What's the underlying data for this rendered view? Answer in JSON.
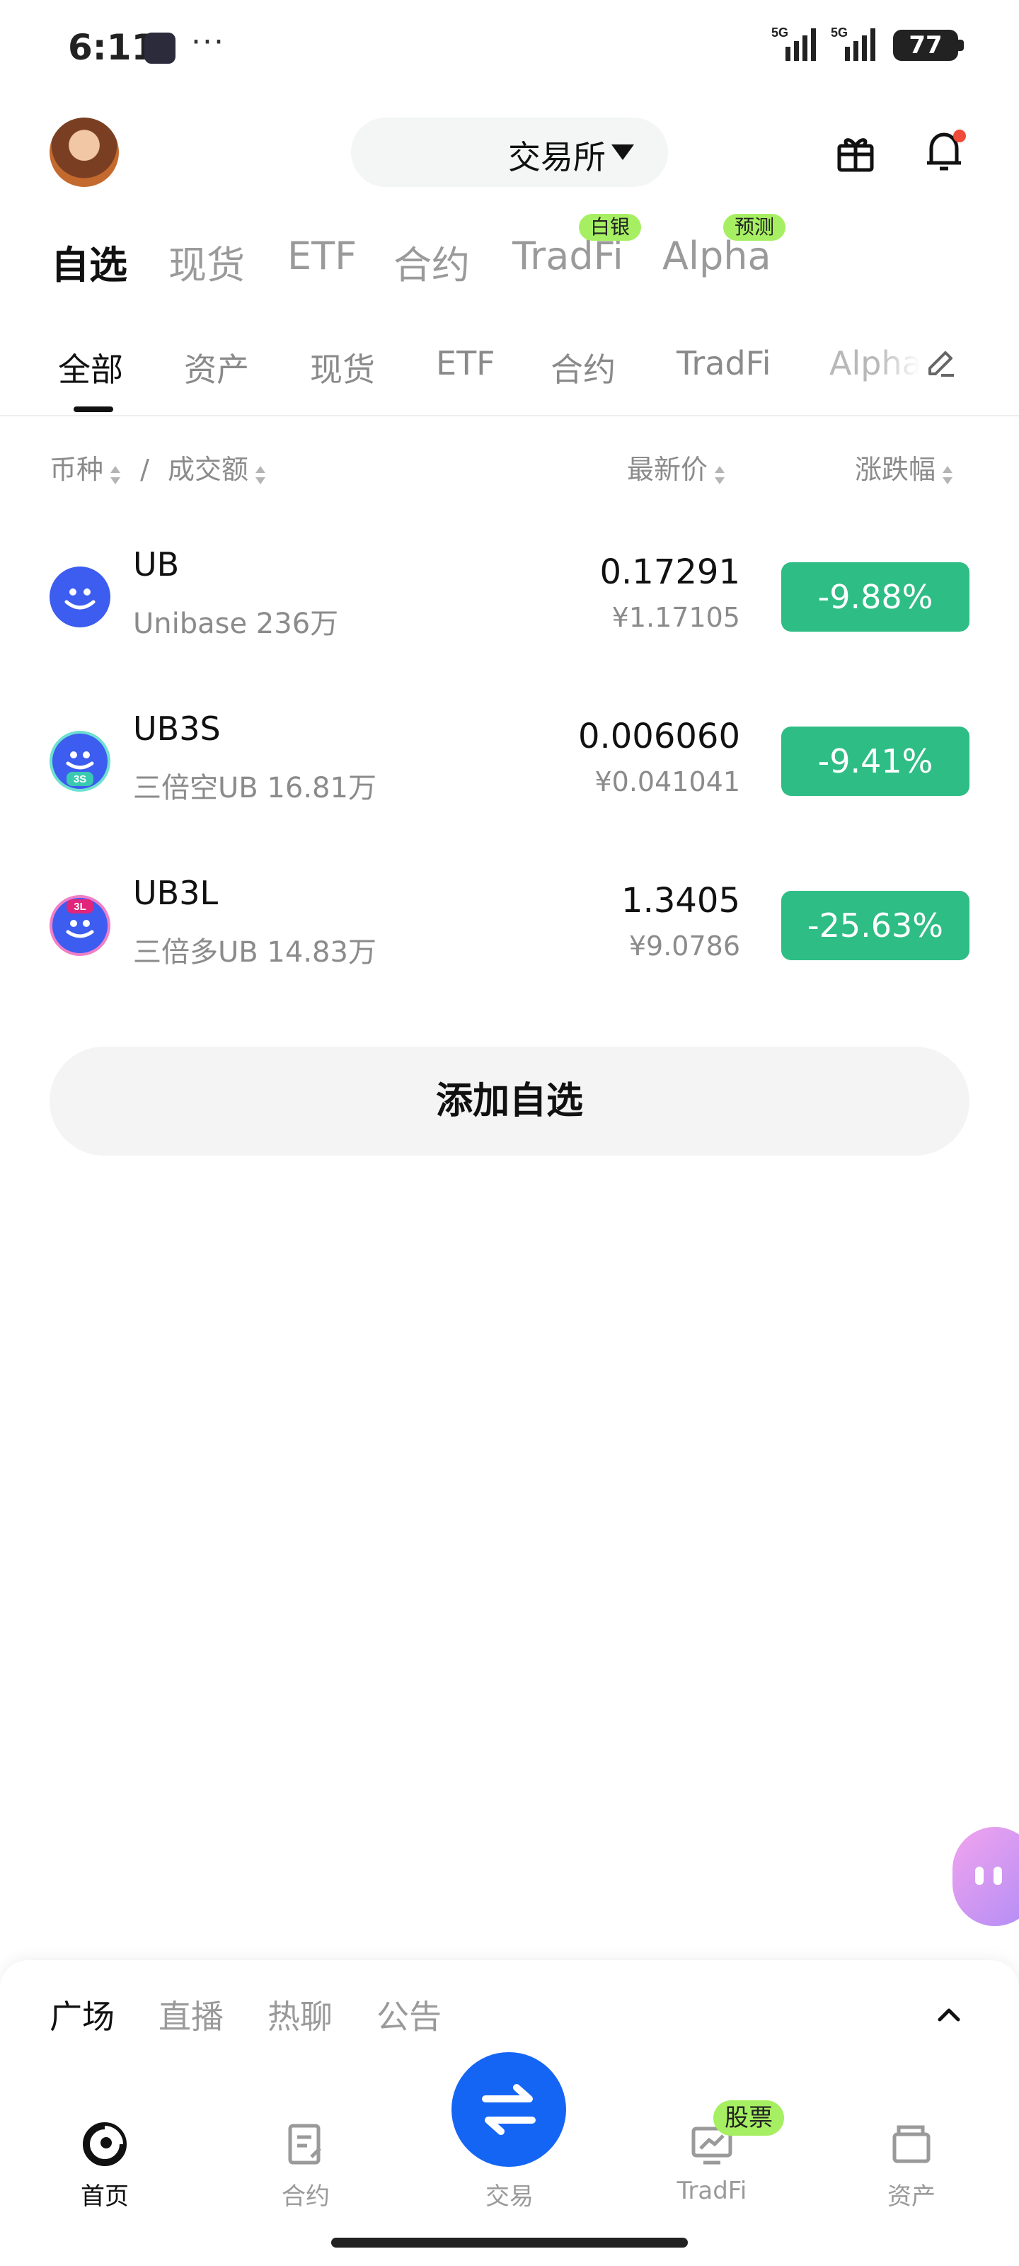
{
  "status_bar": {
    "time": "6:11",
    "dots": "···",
    "network1": "5G",
    "network2": "5G",
    "battery": "77"
  },
  "header": {
    "exchange_label": "交易所"
  },
  "primary_tabs": [
    {
      "label": "自选",
      "active": true
    },
    {
      "label": "现货"
    },
    {
      "label": "ETF"
    },
    {
      "label": "合约"
    },
    {
      "label": "TradFi",
      "badge": "白银"
    },
    {
      "label": "Alpha",
      "badge": "预测"
    }
  ],
  "secondary_tabs": [
    {
      "label": "全部",
      "active": true
    },
    {
      "label": "资产"
    },
    {
      "label": "现货"
    },
    {
      "label": "ETF"
    },
    {
      "label": "合约"
    },
    {
      "label": "TradFi"
    },
    {
      "label": "Alpha"
    }
  ],
  "list_header": {
    "coin": "币种",
    "separator": "/",
    "volume": "成交额",
    "price": "最新价",
    "change": "涨跌幅"
  },
  "rows": [
    {
      "symbol": "UB",
      "subtitle": "Unibase 236万",
      "price": "0.17291",
      "price_cny": "¥1.17105",
      "change": "-9.88%",
      "logo_badge": ""
    },
    {
      "symbol": "UB3S",
      "subtitle": "三倍空UB 16.81万",
      "price": "0.006060",
      "price_cny": "¥0.041041",
      "change": "-9.41%",
      "logo_badge": "3S"
    },
    {
      "symbol": "UB3L",
      "subtitle": "三倍多UB 14.83万",
      "price": "1.3405",
      "price_cny": "¥9.0786",
      "change": "-25.63%",
      "logo_badge": "3L"
    }
  ],
  "add_button": "添加自选",
  "feed_tabs": [
    {
      "label": "广场",
      "active": true
    },
    {
      "label": "直播"
    },
    {
      "label": "热聊"
    },
    {
      "label": "公告"
    }
  ],
  "bottom_nav": [
    {
      "label": "首页",
      "icon": "home-icon",
      "active": true
    },
    {
      "label": "合约",
      "icon": "futures-icon"
    },
    {
      "label": "交易",
      "icon": "swap-icon"
    },
    {
      "label": "TradFi",
      "icon": "tradfi-icon",
      "badge": "股票"
    },
    {
      "label": "资产",
      "icon": "wallet-icon"
    }
  ],
  "colors": {
    "change_down": "#2ebd85",
    "badge_green": "#a6ef62",
    "trade_blue": "#1565f5"
  }
}
